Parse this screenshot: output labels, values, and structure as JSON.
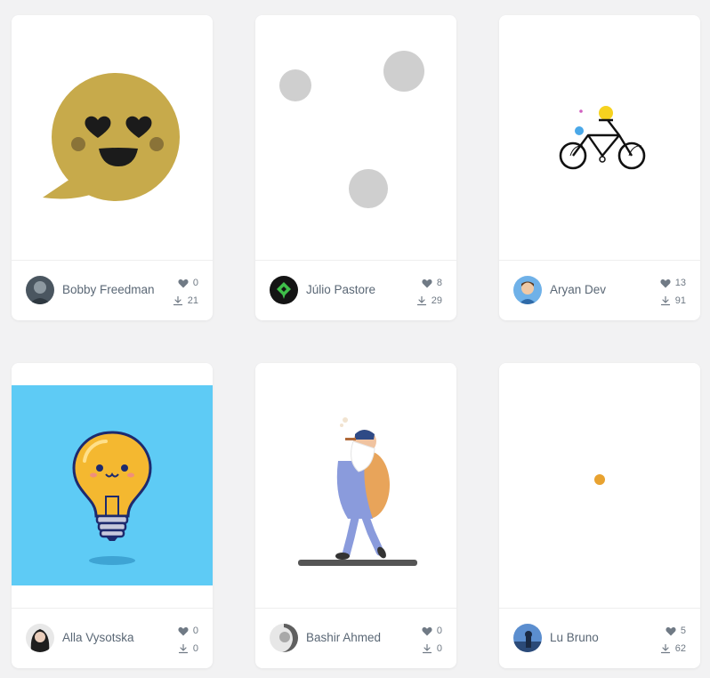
{
  "cards": [
    {
      "author": "Bobby Freedman",
      "likes": "0",
      "downloads": "21"
    },
    {
      "author": "Júlio Pastore",
      "likes": "8",
      "downloads": "29"
    },
    {
      "author": "Aryan Dev",
      "likes": "13",
      "downloads": "91"
    },
    {
      "author": "Alla Vysotska",
      "likes": "0",
      "downloads": "0"
    },
    {
      "author": "Bashir Ahmed",
      "likes": "0",
      "downloads": "0"
    },
    {
      "author": "Lu Bruno",
      "likes": "5",
      "downloads": "62"
    }
  ],
  "icons": {
    "like": "heart-icon",
    "download": "download-icon"
  },
  "colors": {
    "page_background": "#f2f2f3",
    "card_background": "#ffffff",
    "emoji_gold": "#c7aa4b",
    "bulb_background": "#5ecbf5",
    "accent_orange": "#e8a230"
  }
}
